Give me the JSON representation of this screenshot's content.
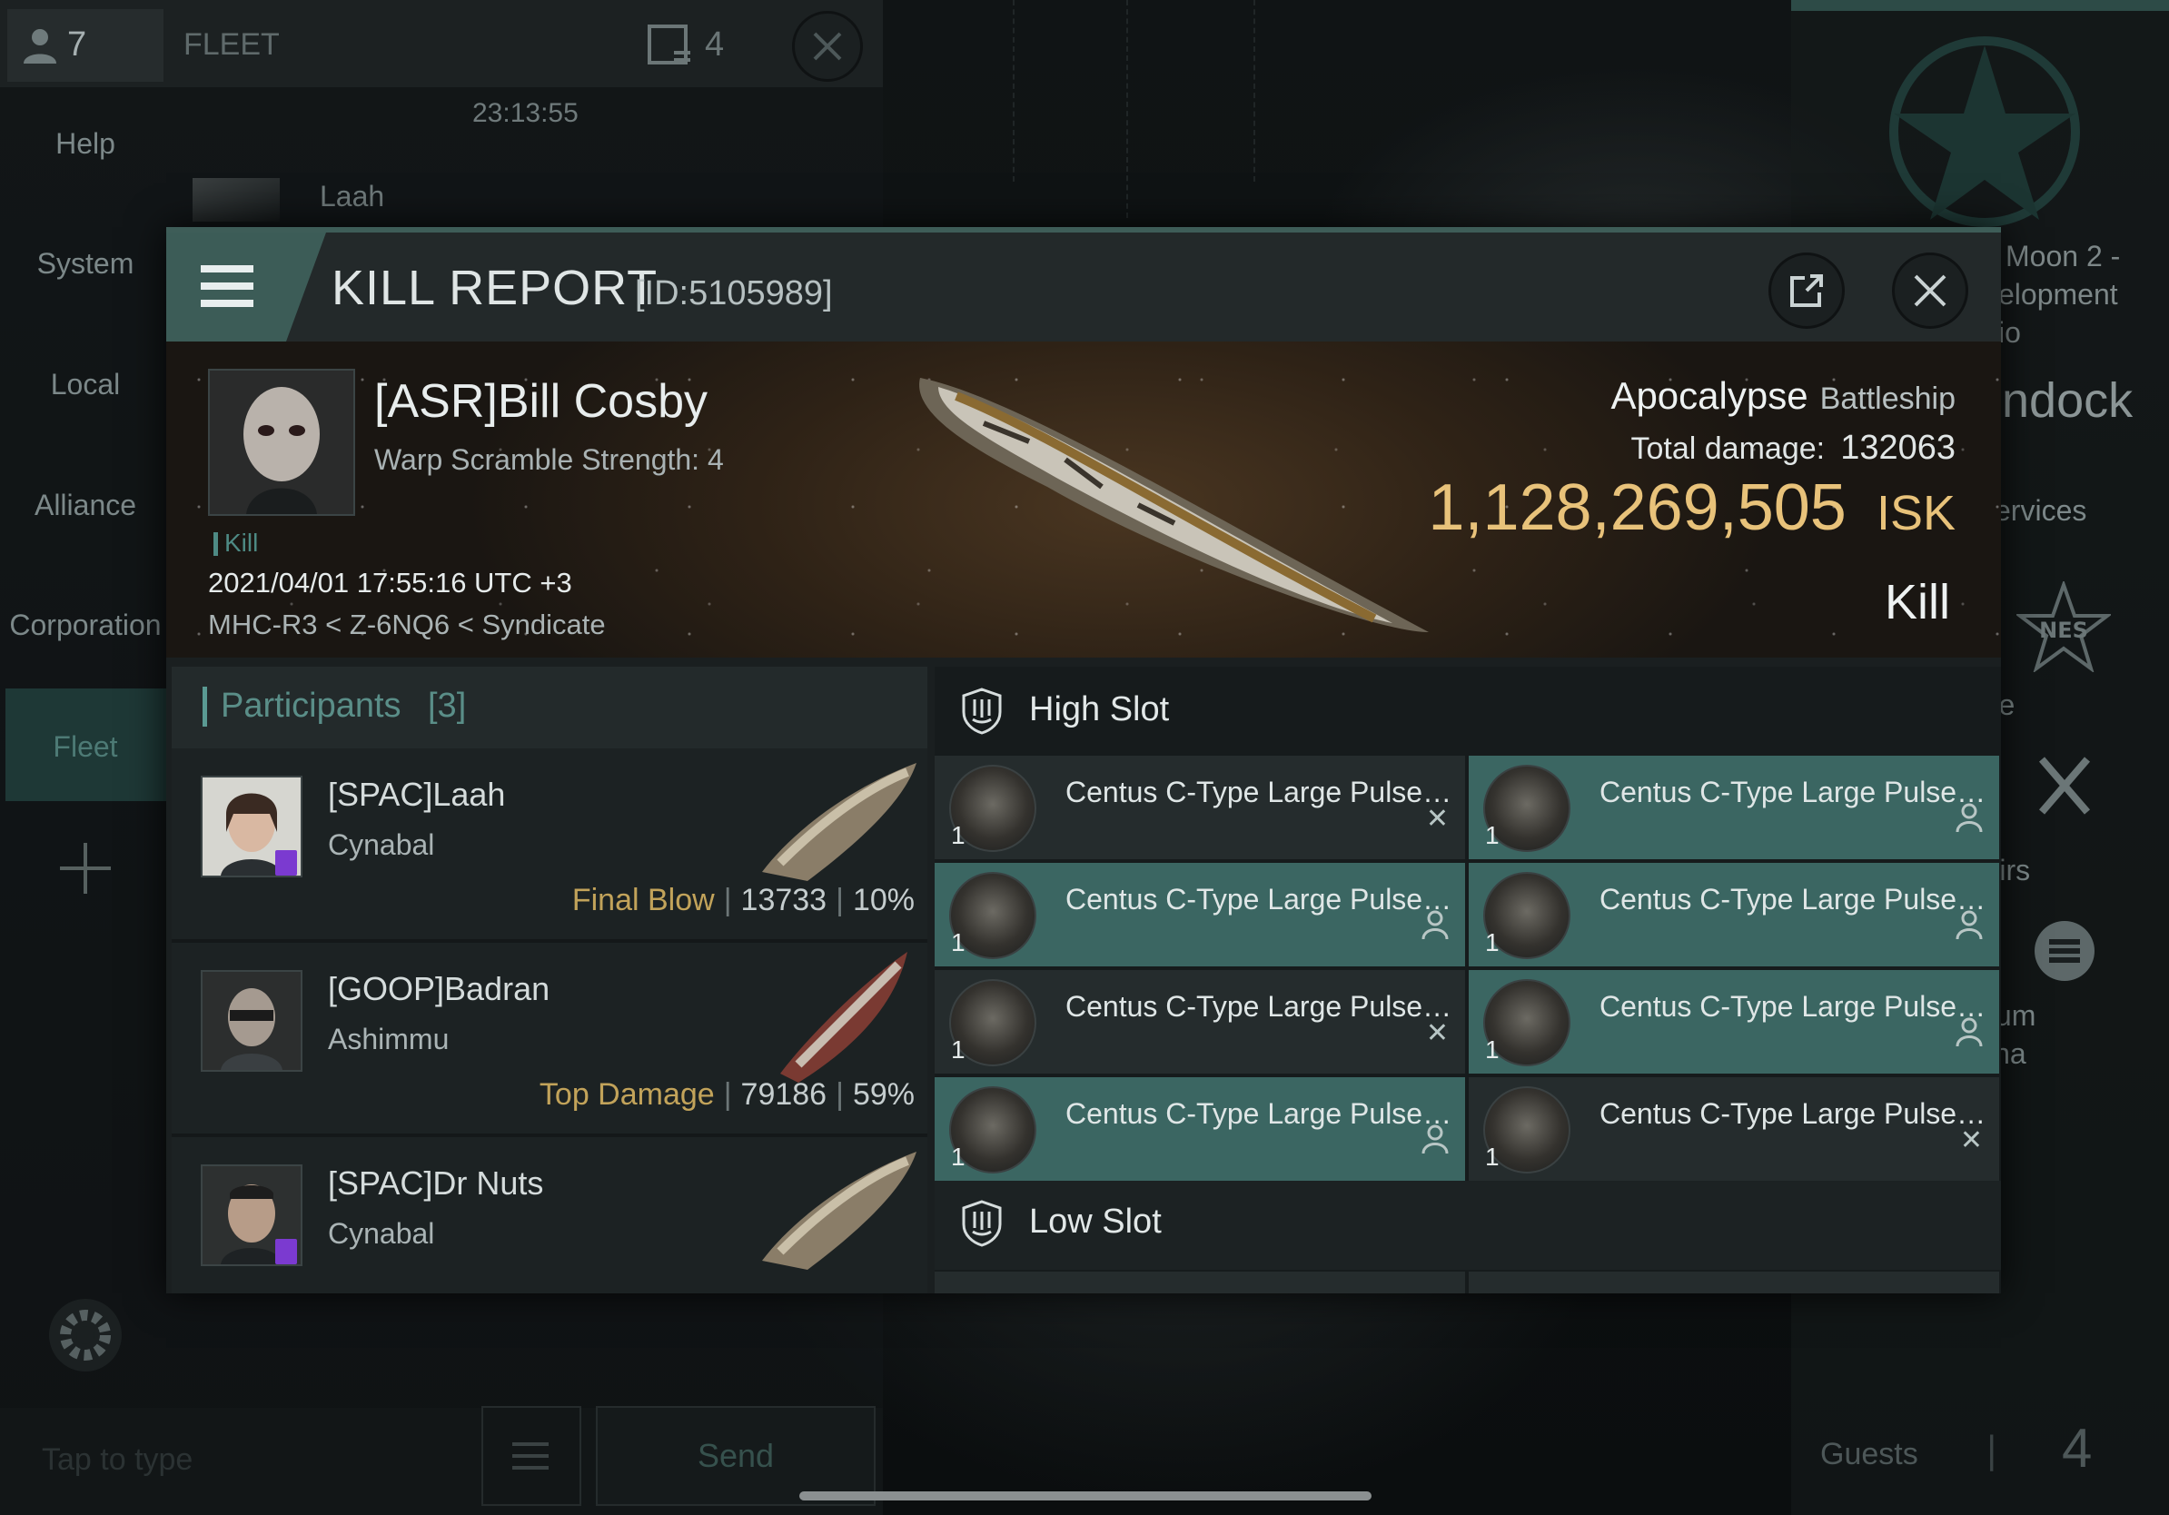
{
  "chat": {
    "member_count": "7",
    "channel_title": "FLEET",
    "window_count": "4",
    "timestamp": "23:13:55",
    "last_sender": "Laah",
    "sidebar": [
      "Help",
      "System",
      "Local",
      "Alliance",
      "Corporation",
      "Fleet"
    ],
    "send_label": "Send",
    "input_placeholder": "Tap to type"
  },
  "right_panel": {
    "location_line1": "Moon 2 -",
    "location_line2": "elopment",
    "location_line3": "io",
    "undock_label": "ndock",
    "services_label": "ervices",
    "store_label": "Store",
    "repairs_label": "Repairs",
    "museum_label1": "Museum",
    "museum_label2": "Arcana",
    "guests_label": "Guests",
    "guests_count": "4"
  },
  "kill_report": {
    "title": "KILL REPORT",
    "report_id": "[ID:5105989]",
    "victim": {
      "name": "[ASR]Bill Cosby",
      "detail": "Warp Scramble Strength: 4",
      "tag": "Kill",
      "datetime": "2021/04/01 17:55:16 UTC +3",
      "location": "MHC-R3 < Z-6NQ6 < Syndicate",
      "ship_name": "Apocalypse",
      "ship_class": "Battleship",
      "total_damage_label": "Total damage:",
      "total_damage": "132063",
      "isk_value": "1,128,269,505",
      "isk_unit": "ISK",
      "result": "Kill"
    },
    "participants": {
      "title": "Participants",
      "count": "[3]",
      "rows": [
        {
          "name": "[SPAC]Laah",
          "ship": "Cynabal",
          "role": "Final Blow",
          "damage": "13733",
          "percent": "10%"
        },
        {
          "name": "[GOOP]Badran",
          "ship": "Ashimmu",
          "role": "Top Damage",
          "damage": "79186",
          "percent": "59%"
        },
        {
          "name": "[SPAC]Dr Nuts",
          "ship": "Cynabal",
          "role": "",
          "damage": "",
          "percent": ""
        }
      ]
    },
    "high_slot": {
      "title": "High Slot",
      "items": [
        {
          "name": "Centus C-Type Large Pulse Laser",
          "qty": "1",
          "status": "destroyed"
        },
        {
          "name": "Centus C-Type Large Pulse Laser",
          "qty": "1",
          "status": "dropped"
        },
        {
          "name": "Centus C-Type Large Pulse Laser",
          "qty": "1",
          "status": "dropped"
        },
        {
          "name": "Centus C-Type Large Pulse Laser",
          "qty": "1",
          "status": "dropped"
        },
        {
          "name": "Centus C-Type Large Pulse Laser",
          "qty": "1",
          "status": "destroyed"
        },
        {
          "name": "Centus C-Type Large Pulse Laser",
          "qty": "1",
          "status": "dropped"
        },
        {
          "name": "Centus C-Type Large Pulse Laser",
          "qty": "1",
          "status": "dropped"
        },
        {
          "name": "Centus C-Type Large Pulse Laser",
          "qty": "1",
          "status": "destroyed"
        }
      ]
    },
    "low_slot": {
      "title": "Low Slot"
    }
  },
  "colors": {
    "accent_teal": "#3b6662",
    "gold_isk": "#e8c27a",
    "role_label": "#c2a35a"
  }
}
